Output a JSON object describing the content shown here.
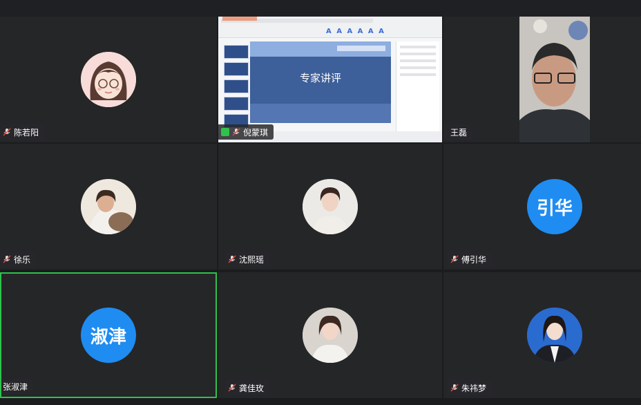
{
  "participants": [
    {
      "name": "陈若阳",
      "avatar": "cartoon-girl-avatar",
      "muted": true
    },
    {
      "name": "倪蒙琪",
      "screen_share": true,
      "muted": true,
      "slide_title": "专家讲评",
      "ribbon_letters": "A A A A A A"
    },
    {
      "name": "王磊",
      "video": true
    },
    {
      "name": "徐乐",
      "avatar": "photo-avatar",
      "muted": true
    },
    {
      "name": "沈熙瑶",
      "avatar": "photo-avatar",
      "muted": true
    },
    {
      "name": "傅引华",
      "avatar_text": "引华",
      "muted": true
    },
    {
      "name": "张淑津",
      "avatar_text": "淑津",
      "active_speaker": true
    },
    {
      "name": "龚佳玫",
      "avatar": "photo-avatar",
      "muted": true
    },
    {
      "name": "朱祎梦",
      "avatar": "photo-avatar",
      "muted": true
    }
  ],
  "colors": {
    "avatar_bg": "#1f8cf1",
    "active_border": "#2fc24d",
    "tile_bg": "#252628"
  }
}
